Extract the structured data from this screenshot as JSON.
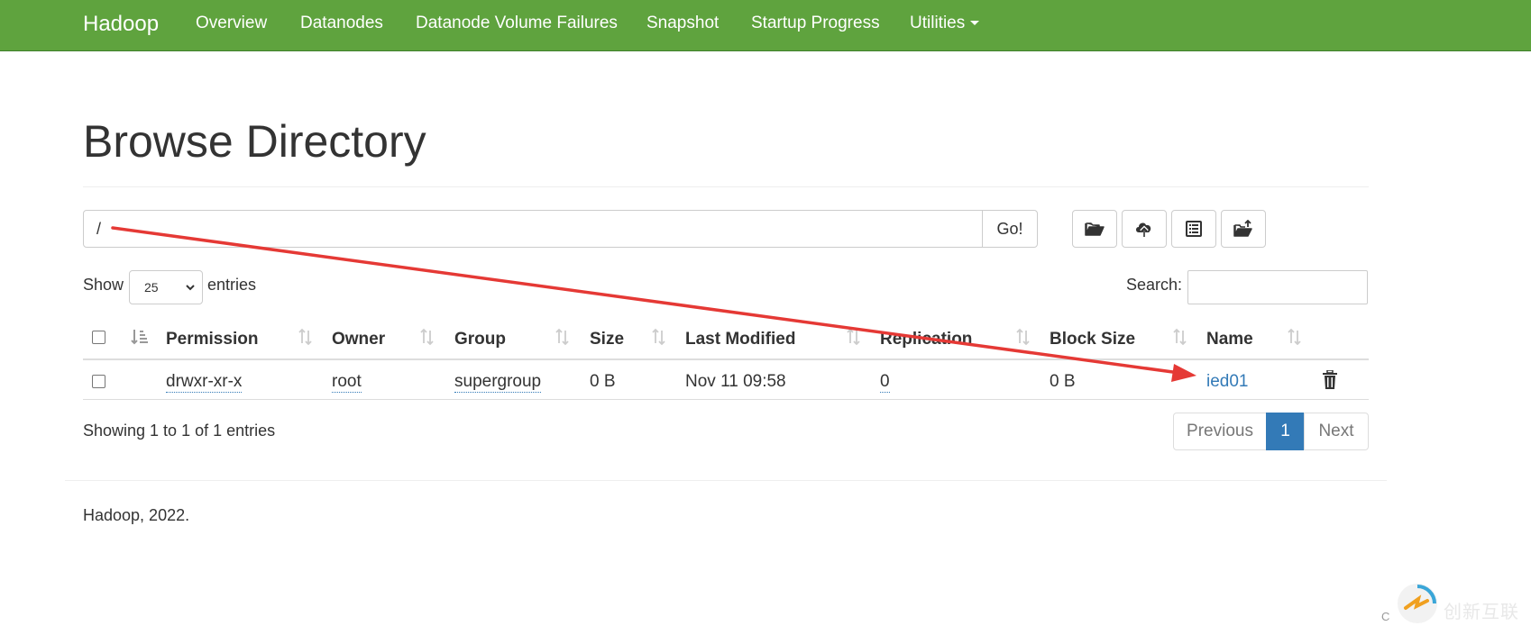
{
  "navbar": {
    "brand": "Hadoop",
    "items": [
      "Overview",
      "Datanodes",
      "Datanode Volume Failures",
      "Snapshot",
      "Startup Progress"
    ],
    "utilities": "Utilities",
    "color": "#5fa33e"
  },
  "page": {
    "title": "Browse Directory"
  },
  "path_bar": {
    "value": "/",
    "go_label": "Go!",
    "toolbar_icons": [
      "folder-open-icon",
      "cloud-upload-icon",
      "list-alt-icon",
      "folder-upload-icon"
    ]
  },
  "table_controls": {
    "show_label": "Show",
    "page_length": "25",
    "entries_label": "entries",
    "search_label": "Search:",
    "search_value": ""
  },
  "table": {
    "columns": [
      "Permission",
      "Owner",
      "Group",
      "Size",
      "Last Modified",
      "Replication",
      "Block Size",
      "Name"
    ],
    "rows": [
      {
        "permission": "drwxr-xr-x",
        "owner": "root",
        "group": "supergroup",
        "size": "0 B",
        "last_modified": "Nov 11 09:58",
        "replication": "0",
        "block_size": "0 B",
        "name": "ied01"
      }
    ]
  },
  "pagination": {
    "info": "Showing 1 to 1 of 1 entries",
    "previous": "Previous",
    "current": "1",
    "next": "Next"
  },
  "footer": {
    "text": "Hadoop, 2022."
  },
  "watermark": {
    "text": "创新互联",
    "cs": "C"
  },
  "annotation": {
    "color": "#e53935"
  }
}
